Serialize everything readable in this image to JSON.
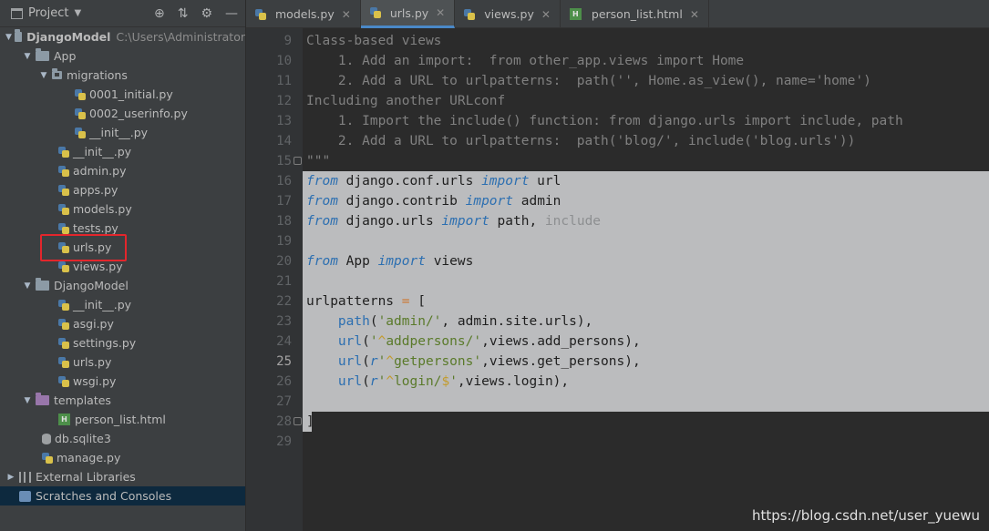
{
  "project_panel": {
    "title": "Project",
    "icons": [
      "globe-icon",
      "collapse-icon",
      "gear-icon",
      "minimize-icon"
    ]
  },
  "tree": {
    "root": {
      "label": "DjangoModel",
      "path": "C:\\Users\\Administrator"
    },
    "app": "App",
    "migrations": "migrations",
    "mig_0001": "0001_initial.py",
    "mig_0002": "0002_userinfo.py",
    "mig_init": "__init__.py",
    "app_init": "__init__.py",
    "admin": "admin.py",
    "apps": "apps.py",
    "models": "models.py",
    "tests": "tests.py",
    "urls": "urls.py",
    "views": "views.py",
    "pkg": "DjangoModel",
    "pkg_init": "__init__.py",
    "asgi": "asgi.py",
    "settings": "settings.py",
    "pkg_urls": "urls.py",
    "wsgi": "wsgi.py",
    "templates": "templates",
    "person_list": "person_list.html",
    "db": "db.sqlite3",
    "manage": "manage.py",
    "external": "External Libraries",
    "scratches": "Scratches and Consoles"
  },
  "tabs": [
    {
      "label": "models.py",
      "active": false
    },
    {
      "label": "urls.py",
      "active": true
    },
    {
      "label": "views.py",
      "active": false
    },
    {
      "label": "person_list.html",
      "active": false
    }
  ],
  "editor": {
    "line_numbers": [
      "9",
      "10",
      "11",
      "12",
      "13",
      "14",
      "15",
      "16",
      "17",
      "18",
      "19",
      "20",
      "21",
      "22",
      "23",
      "24",
      "25",
      "26",
      "27",
      "28",
      "29"
    ],
    "current_line": "25",
    "code": {
      "l9": "Class-based views",
      "l10": "    1. Add an import:  from other_app.views import Home",
      "l11": "    2. Add a URL to urlpatterns:  path('', Home.as_view(), name='home')",
      "l12": "Including another URLconf",
      "l13": "    1. Import the include() function: from django.urls import include, path",
      "l14": "    2. Add a URL to urlpatterns:  path('blog/', include('blog.urls'))",
      "l15": "\"\"\"",
      "l16": {
        "kw1": "from",
        "mod": " django.conf.urls ",
        "kw2": "import",
        "name": " url"
      },
      "l17": {
        "kw1": "from",
        "mod": " django.contrib ",
        "kw2": "import",
        "name": " admin"
      },
      "l18": {
        "kw1": "from",
        "mod": " django.urls ",
        "kw2": "import",
        "name": " path, ",
        "unused": "include"
      },
      "l20": {
        "kw1": "from",
        "mod": " App ",
        "kw2": "import",
        "name": " views"
      },
      "l22": {
        "name": "urlpatterns ",
        "op": "=",
        "rest": " ["
      },
      "l23": {
        "indent": "    ",
        "fn": "path",
        "a": "(",
        "s": "'admin/'",
        "b": ", admin.site.urls),"
      },
      "l24": {
        "indent": "    ",
        "fn": "url",
        "a": "(",
        "s1": "'",
        "sc": "^",
        "s2": "addpersons/'",
        "b": ",views.add_persons),"
      },
      "l25": {
        "indent": "    ",
        "fn": "url",
        "a": "(",
        "r": "r",
        "s1": "'",
        "sc": "^",
        "s2": "getpersons'",
        "b": ",views.get_persons),"
      },
      "l26": {
        "indent": "    ",
        "fn": "url",
        "a": "(",
        "r": "r",
        "s1": "'",
        "sc": "^",
        "s2": "login/",
        "sc2": "$",
        "s3": "'",
        "b": ",views.login),"
      },
      "l28": "]"
    }
  },
  "watermark": "https://blog.csdn.net/user_yuewu"
}
